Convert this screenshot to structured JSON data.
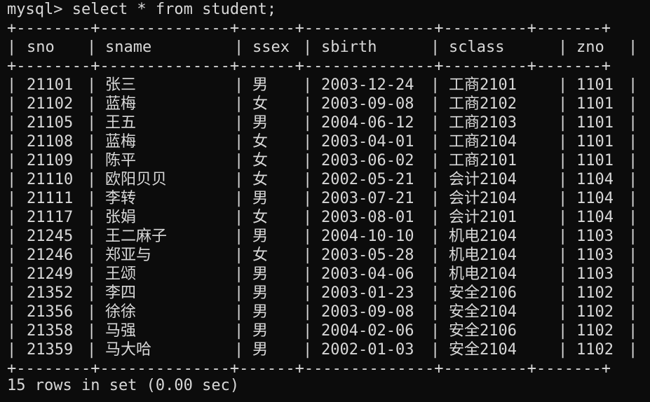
{
  "terminal": {
    "prompt": "mysql> select * from student;",
    "border": "+--------+--------------+------+--------------+---------+-------+",
    "columns": [
      "sno",
      "sname",
      "ssex",
      "sbirth",
      "sclass",
      "zno"
    ],
    "rows": [
      [
        "21101",
        "张三",
        "男",
        "2003-12-24",
        "工商2101",
        "1101"
      ],
      [
        "21102",
        "蓝梅",
        "女",
        "2003-09-08",
        "工商2102",
        "1101"
      ],
      [
        "21105",
        "王五",
        "男",
        "2004-06-12",
        "工商2103",
        "1101"
      ],
      [
        "21108",
        "蓝梅",
        "女",
        "2003-04-01",
        "工商2104",
        "1101"
      ],
      [
        "21109",
        "陈平",
        "女",
        "2003-06-02",
        "工商2101",
        "1101"
      ],
      [
        "21110",
        "欧阳贝贝",
        "女",
        "2002-05-21",
        "会计2104",
        "1104"
      ],
      [
        "21111",
        "李转",
        "男",
        "2003-07-21",
        "会计2104",
        "1104"
      ],
      [
        "21117",
        "张娟",
        "女",
        "2003-08-01",
        "会计2101",
        "1104"
      ],
      [
        "21245",
        "王二麻子",
        "男",
        "2004-10-10",
        "机电2104",
        "1103"
      ],
      [
        "21246",
        "郑亚与",
        "女",
        "2003-05-28",
        "机电2104",
        "1103"
      ],
      [
        "21249",
        "王颂",
        "男",
        "2003-04-06",
        "机电2104",
        "1103"
      ],
      [
        "21352",
        "李四",
        "男",
        "2003-01-23",
        "安全2106",
        "1102"
      ],
      [
        "21356",
        "徐徐",
        "男",
        "2003-09-08",
        "安全2104",
        "1102"
      ],
      [
        "21358",
        "马强",
        "男",
        "2004-02-06",
        "安全2106",
        "1102"
      ],
      [
        "21359",
        "马大哈",
        "男",
        "2002-01-03",
        "安全2104",
        "1102"
      ]
    ],
    "summary": "15 rows in set (0.00 sec)"
  },
  "colors": {
    "background": "#0c0c0c",
    "text": "#d8d8d8"
  }
}
